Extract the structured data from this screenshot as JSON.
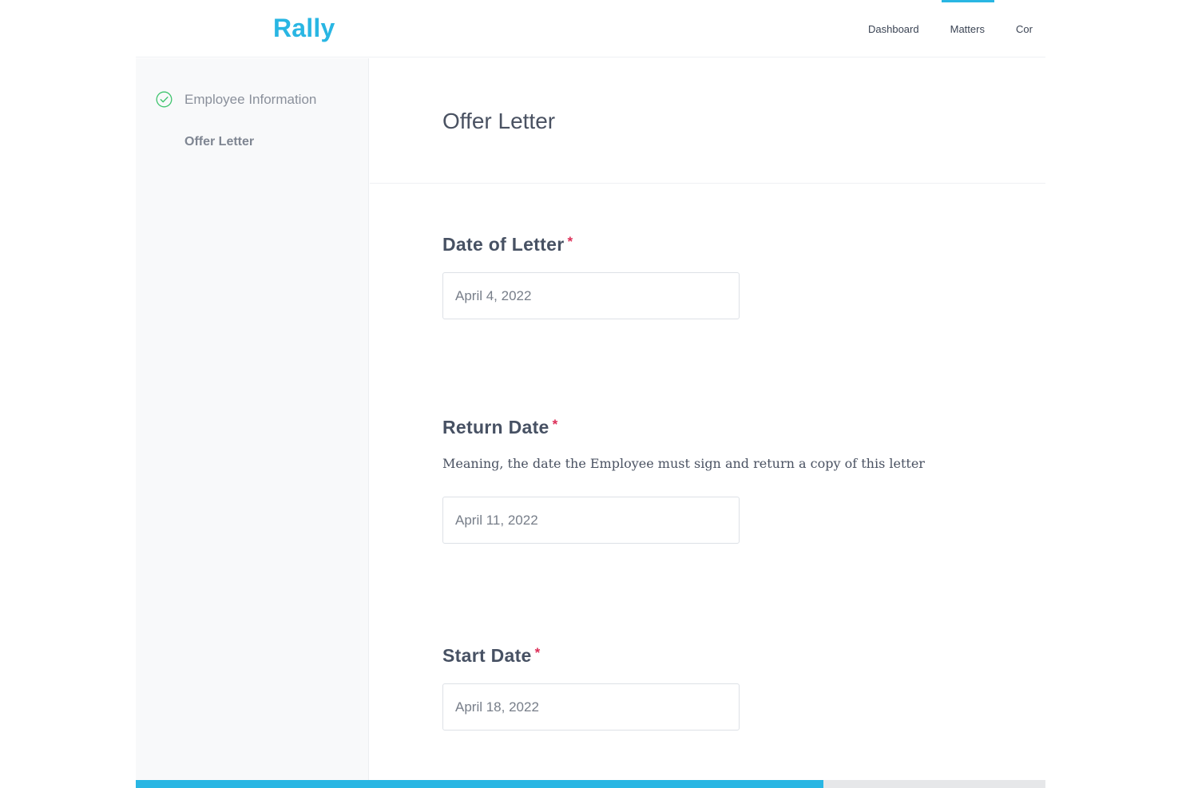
{
  "header": {
    "logo": "Rally",
    "nav": [
      {
        "label": "Dashboard",
        "active": false
      },
      {
        "label": "Matters",
        "active": true
      },
      {
        "label": "Cor",
        "active": false
      }
    ]
  },
  "sidebar": {
    "items": [
      {
        "label": "Employee Information",
        "status": "completed",
        "icon": "check-circle-icon"
      },
      {
        "label": "Offer Letter",
        "status": "current"
      }
    ]
  },
  "main": {
    "title": "Offer Letter",
    "fields": [
      {
        "label": "Date of Letter",
        "required_mark": "*",
        "help": "",
        "value": "April 4, 2022"
      },
      {
        "label": "Return Date",
        "required_mark": "*",
        "help": "Meaning, the date the Employee must sign and return a copy of this letter",
        "value": "April 11, 2022"
      },
      {
        "label": "Start Date",
        "required_mark": "*",
        "help": "",
        "value": "April 18, 2022"
      }
    ]
  },
  "progress": {
    "fraction": 0.756
  },
  "colors": {
    "accent": "#29b6e3",
    "required": "#dc2e57",
    "success": "#3ec46d"
  }
}
